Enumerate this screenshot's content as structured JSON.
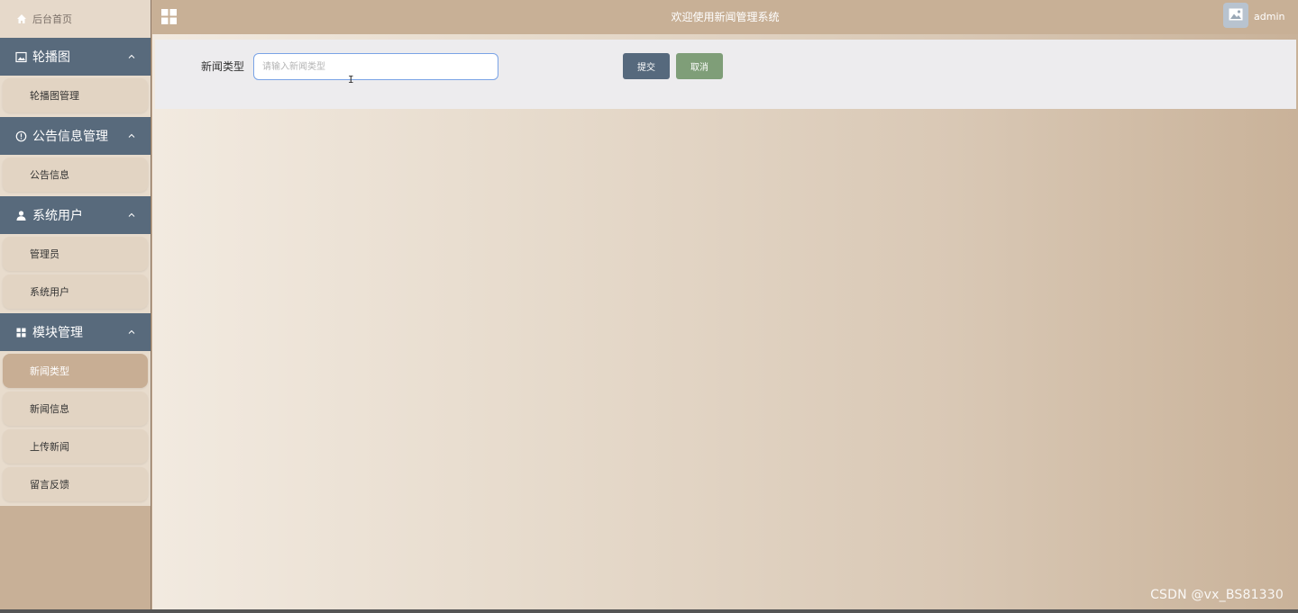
{
  "sidebar": {
    "home_label": "后台首页",
    "groups": [
      {
        "title": "轮播图",
        "icon": "image-icon",
        "items": [
          {
            "label": "轮播图管理"
          }
        ]
      },
      {
        "title": "公告信息管理",
        "icon": "info-circle-icon",
        "items": [
          {
            "label": "公告信息"
          }
        ]
      },
      {
        "title": "系统用户",
        "icon": "user-icon",
        "items": [
          {
            "label": "管理员"
          },
          {
            "label": "系统用户"
          }
        ]
      },
      {
        "title": "模块管理",
        "icon": "grid-icon",
        "items": [
          {
            "label": "新闻类型"
          },
          {
            "label": "新闻信息"
          },
          {
            "label": "上传新闻"
          },
          {
            "label": "留言反馈"
          }
        ]
      }
    ]
  },
  "header": {
    "title": "欢迎使用新闻管理系统",
    "username": "admin"
  },
  "form": {
    "label": "新闻类型",
    "input_value": "",
    "placeholder": "请输入新闻类型",
    "submit_label": "提交",
    "cancel_label": "取消"
  },
  "watermark": "CSDN @vx_BS81330",
  "colors": {
    "sidebar_group_bg": "#586a7c",
    "active_item_bg": "#c8ae94",
    "submit_button": "#56697d",
    "cancel_button": "#7f9e78",
    "input_border": "#7aa3e6"
  }
}
